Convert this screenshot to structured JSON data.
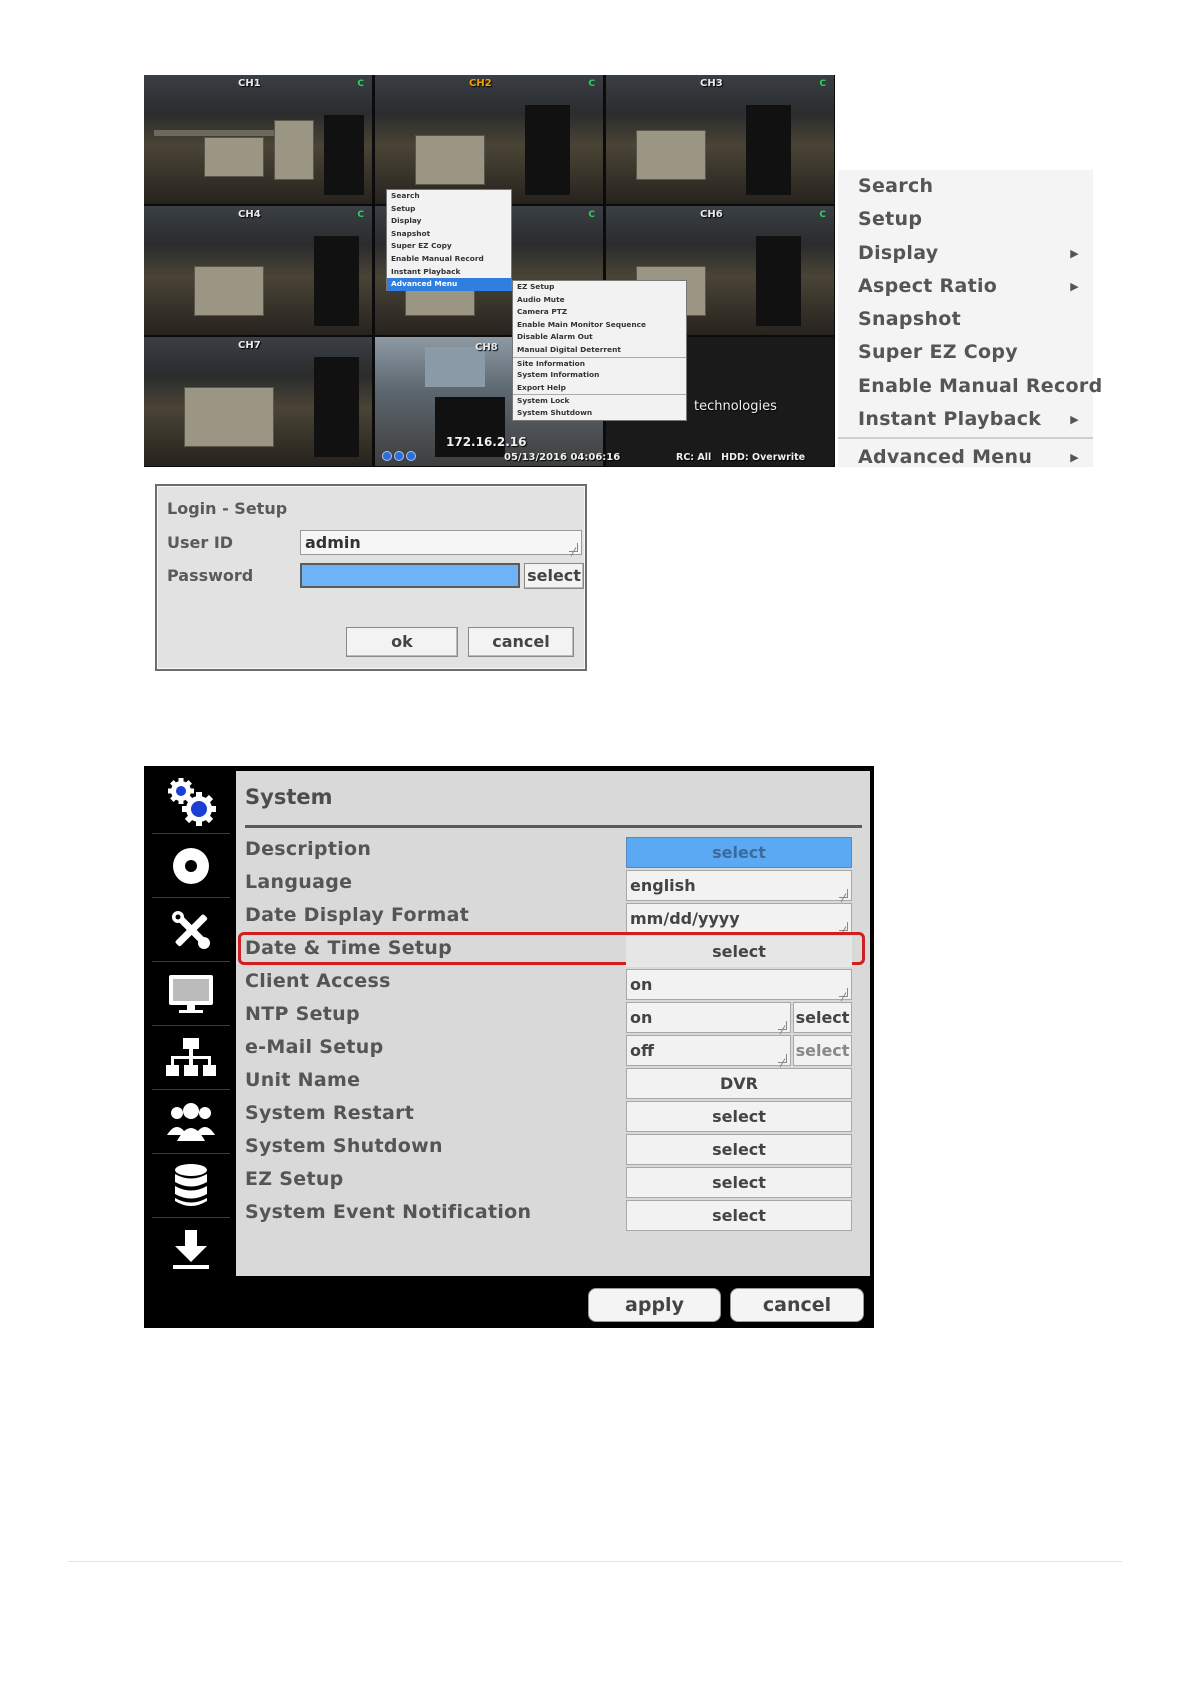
{
  "camera_grid": {
    "channels": [
      "CH1",
      "CH2",
      "CH3",
      "CH4",
      "",
      "CH6",
      "CH7",
      "CH8",
      ""
    ],
    "active_channel": "CH2",
    "context_menu": {
      "items": [
        "Search",
        "Setup",
        "Display",
        "Snapshot",
        "Super EZ Copy",
        "Enable Manual Record",
        "Instant Playback",
        "Advanced Menu"
      ],
      "highlighted": "Advanced Menu"
    },
    "advanced_submenu": {
      "items": [
        "EZ Setup",
        "Audio Mute",
        "Camera PTZ",
        "Enable Main Monitor Sequence",
        "Disable Alarm Out",
        "Manual Digital Deterrent",
        "Site Information",
        "System Information",
        "Export Help",
        "System Lock",
        "System Shutdown"
      ]
    },
    "watermark": "technologies",
    "ip_overlay": "172.16.2.16",
    "timestamp": "05/13/2016 04:06:16",
    "status": "RC: All   HDD: Overwrite"
  },
  "side_menu": {
    "items": [
      {
        "label": "Search",
        "arrow": ""
      },
      {
        "label": "Setup",
        "arrow": ""
      },
      {
        "label": "Display",
        "arrow": "▶"
      },
      {
        "label": "Aspect Ratio",
        "arrow": "▶"
      },
      {
        "label": "Snapshot",
        "arrow": ""
      },
      {
        "label": "Super EZ Copy",
        "arrow": ""
      },
      {
        "label": "Enable Manual Record",
        "arrow": ""
      },
      {
        "label": "Instant Playback",
        "arrow": "▶"
      },
      {
        "label": "Advanced Menu",
        "arrow": "▶"
      }
    ]
  },
  "login": {
    "title": "Login - Setup",
    "user_id_label": "User ID",
    "user_id_value": "admin",
    "password_label": "Password",
    "password_value": "",
    "select_label": "select",
    "ok_label": "ok",
    "cancel_label": "cancel"
  },
  "system": {
    "title": "System",
    "rows": [
      {
        "label": "Description",
        "value": "select"
      },
      {
        "label": "Language",
        "value": "english"
      },
      {
        "label": "Date Display Format",
        "value": "mm/dd/yyyy"
      },
      {
        "label": "Date & Time Setup",
        "value": "select"
      },
      {
        "label": "Client Access",
        "value": "on"
      },
      {
        "label": "NTP Setup",
        "value": "on",
        "extra": "select"
      },
      {
        "label": "e-Mail Setup",
        "value": "off",
        "extra": "select"
      },
      {
        "label": "Unit Name",
        "value": "DVR"
      },
      {
        "label": "System Restart",
        "value": "select"
      },
      {
        "label": "System Shutdown",
        "value": "select"
      },
      {
        "label": "EZ Setup",
        "value": "select"
      },
      {
        "label": "System Event Notification",
        "value": "select"
      }
    ],
    "nav_icons": [
      "gears-icon",
      "disc-icon",
      "tools-icon",
      "monitor-icon",
      "network-icon",
      "users-icon",
      "database-icon",
      "download-icon"
    ],
    "apply_label": "apply",
    "cancel_label": "cancel"
  }
}
